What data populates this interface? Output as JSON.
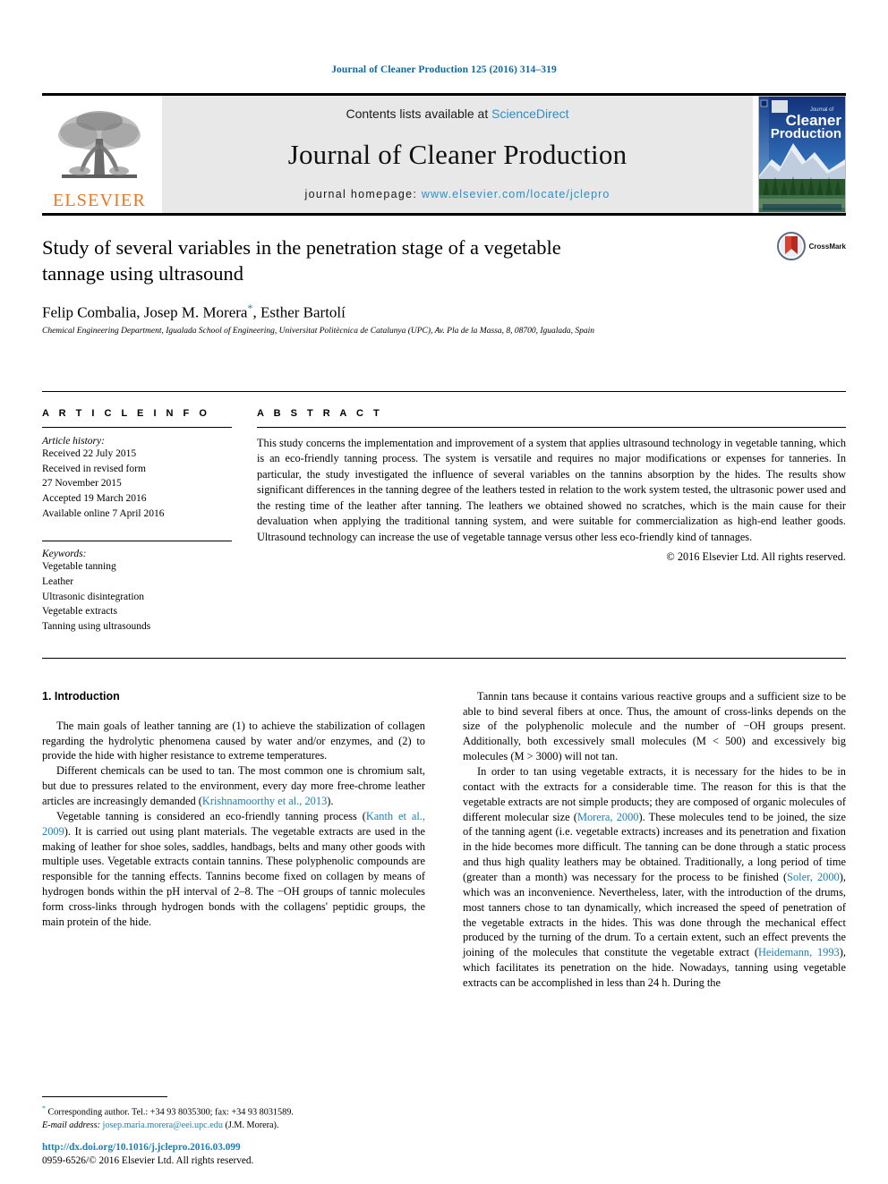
{
  "running_head": "Journal of Cleaner Production 125 (2016) 314–319",
  "masthead": {
    "publisher_logo_text": "ELSEVIER",
    "contents_prefix": "Contents lists available at ",
    "contents_link": "ScienceDirect",
    "journal_name": "Journal of Cleaner Production",
    "homepage_prefix": "journal homepage: ",
    "homepage_url": "www.elsevier.com/locate/jclepro",
    "cover_title_small": "Journal of",
    "cover_title_line1": "Cleaner",
    "cover_title_line2": "Production"
  },
  "article": {
    "title": "Study of several variables in the penetration stage of a vegetable tannage using ultrasound",
    "authors": "Felip Combalia, Josep M. Morera",
    "authors_tail": ", Esther Bartolí",
    "corresponding_marker": "*",
    "affiliation": "Chemical Engineering Department, Igualada School of Engineering, Universitat Politècnica de Catalunya (UPC), Av. Pla de la Massa, 8, 08700, Igualada, Spain",
    "crossmark_label": "CrossMark"
  },
  "article_info": {
    "heading": "A R T I C L E   I N F O",
    "history_label": "Article history:",
    "history": [
      "Received 22 July 2015",
      "Received in revised form",
      "27 November 2015",
      "Accepted 19 March 2016",
      "Available online 7 April 2016"
    ],
    "keywords_label": "Keywords:",
    "keywords": [
      "Vegetable tanning",
      "Leather",
      "Ultrasonic disintegration",
      "Vegetable extracts",
      "Tanning using ultrasounds"
    ]
  },
  "abstract": {
    "heading": "A B S T R A C T",
    "text": "This study concerns the implementation and improvement of a system that applies ultrasound technology in vegetable tanning, which is an eco-friendly tanning process. The system is versatile and requires no major modifications or expenses for tanneries. In particular, the study investigated the influence of several variables on the tannins absorption by the hides. The results show significant differences in the tanning degree of the leathers tested in relation to the work system tested, the ultrasonic power used and the resting time of the leather after tanning. The leathers we obtained showed no scratches, which is the main cause for their devaluation when applying the traditional tanning system, and were suitable for commercialization as high-end leather goods. Ultrasound technology can increase the use of vegetable tannage versus other less eco-friendly kind of tannages.",
    "copyright": "© 2016 Elsevier Ltd. All rights reserved."
  },
  "body": {
    "section_title": "1. Introduction",
    "left_paragraphs": [
      {
        "parts": [
          {
            "t": "The main goals of leather tanning are (1) to achieve the stabilization of collagen regarding the hydrolytic phenomena caused by water and/or enzymes, and (2) to provide the hide with higher resistance to extreme temperatures.",
            "k": "text"
          }
        ]
      },
      {
        "parts": [
          {
            "t": "Different chemicals can be used to tan. The most common one is chromium salt, but due to pressures related to the environment, every day more free-chrome leather articles are increasingly demanded (",
            "k": "text"
          },
          {
            "t": "Krishnamoorthy et al., 2013",
            "k": "ref"
          },
          {
            "t": ").",
            "k": "text"
          }
        ]
      },
      {
        "parts": [
          {
            "t": "Vegetable tanning is considered an eco-friendly tanning process (",
            "k": "text"
          },
          {
            "t": "Kanth et al., 2009",
            "k": "ref"
          },
          {
            "t": "). It is carried out using plant materials. The vegetable extracts are used in the making of leather for shoe soles, saddles, handbags, belts and many other goods with multiple uses. Vegetable extracts contain tannins. These polyphenolic compounds are responsible for the tanning effects. Tannins become fixed on collagen by means of hydrogen bonds within the pH interval of 2–8. The −OH groups of tannic molecules form cross-links through hydrogen bonds with the collagens' peptidic groups, the main protein of the hide.",
            "k": "text"
          }
        ]
      }
    ],
    "right_paragraphs": [
      {
        "parts": [
          {
            "t": "Tannin tans because it contains various reactive groups and a sufficient size to be able to bind several fibers at once. Thus, the amount of cross-links depends on the size of the polyphenolic molecule and the number of −OH groups present. Additionally, both excessively small molecules (M < 500) and excessively big molecules (M > 3000) will not tan.",
            "k": "text"
          }
        ]
      },
      {
        "parts": [
          {
            "t": "In order to tan using vegetable extracts, it is necessary for the hides to be in contact with the extracts for a considerable time. The reason for this is that the vegetable extracts are not simple products; they are composed of organic molecules of different molecular size (",
            "k": "text"
          },
          {
            "t": "Morera, 2000",
            "k": "ref"
          },
          {
            "t": "). These molecules tend to be joined, the size of the tanning agent (i.e. vegetable extracts) increases and its penetration and fixation in the hide becomes more difficult. The tanning can be done through a static process and thus high quality leathers may be obtained. Traditionally, a long period of time (greater than a month) was necessary for the process to be finished (",
            "k": "text"
          },
          {
            "t": "Soler, 2000",
            "k": "ref"
          },
          {
            "t": "), which was an inconvenience. Nevertheless, later, with the introduction of the drums, most tanners chose to tan dynamically, which increased the speed of penetration of the vegetable extracts in the hides. This was done through the mechanical effect produced by the turning of the drum. To a certain extent, such an effect prevents the joining of the molecules that constitute the vegetable extract (",
            "k": "text"
          },
          {
            "t": "Heidemann, 1993",
            "k": "ref"
          },
          {
            "t": "), which facilitates its penetration on the hide. Nowadays, tanning using vegetable extracts can be accomplished in less than 24 h. During the",
            "k": "text"
          }
        ]
      }
    ]
  },
  "footnotes": {
    "corresponding": "Corresponding author. Tel.: +34 93 8035300; fax: +34 93 8031589.",
    "email_label": "E-mail address:",
    "email": "josep.maria.morera@eei.upc.edu",
    "email_suffix": "(J.M. Morera).",
    "doi": "http://dx.doi.org/10.1016/j.jclepro.2016.03.099",
    "issn": "0959-6526/© 2016 Elsevier Ltd. All rights reserved."
  },
  "colors": {
    "link": "#1a7fb5",
    "elsevier_orange": "#E87722",
    "sciencedirect_blue": "#2b8fc9"
  }
}
